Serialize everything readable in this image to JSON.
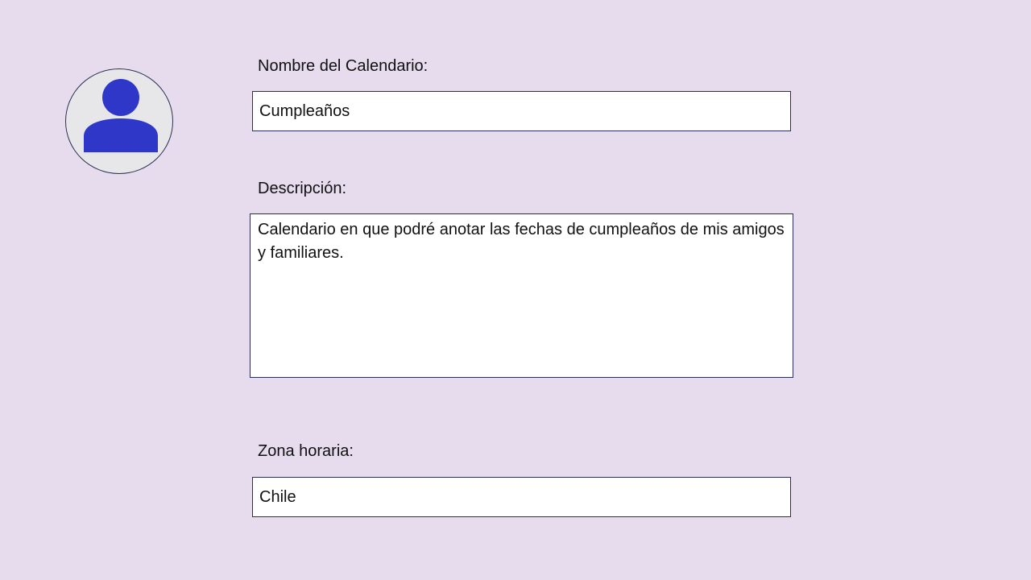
{
  "form": {
    "avatar_icon": "user-icon",
    "name_label": "Nombre del Calendario:",
    "name_value": "Cumpleaños",
    "description_label": "Descripción:",
    "description_value": "Calendario en que podré anotar las fechas de cumpleaños de mis amigos y familiares.",
    "timezone_label": "Zona horaria:",
    "timezone_value": "Chile"
  },
  "colors": {
    "background": "#e6dcee",
    "avatar_fill": "#e7e6e8",
    "avatar_icon": "#2e37c8",
    "border": "#2b2f55",
    "field_background": "#ffffff"
  }
}
